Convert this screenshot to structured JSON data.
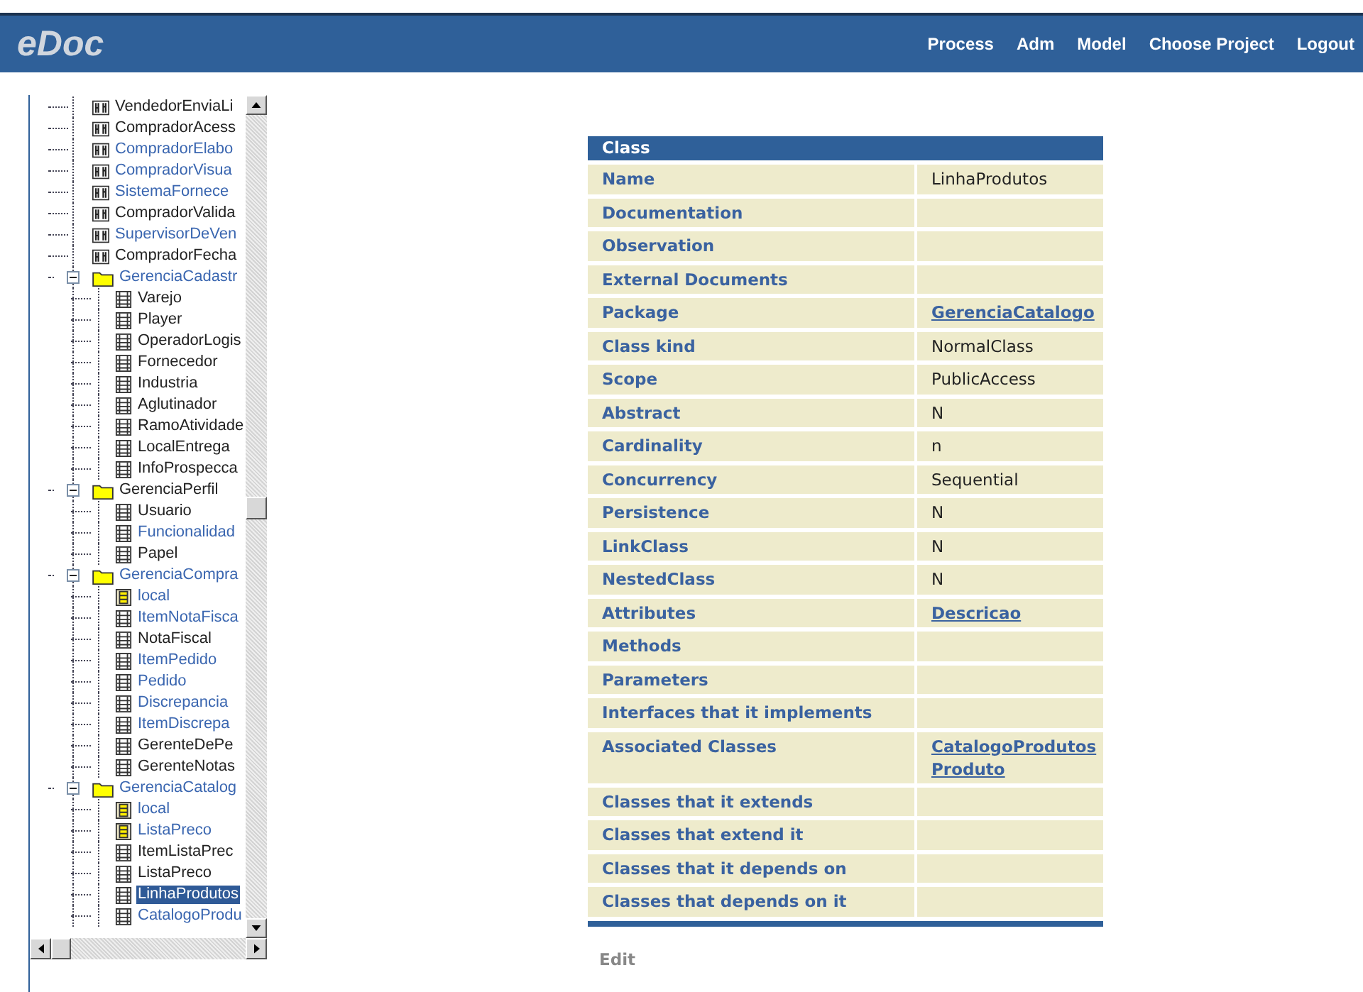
{
  "header": {
    "logo": "eDoc",
    "nav": [
      "Process",
      "Adm",
      "Model",
      "Choose Project",
      "Logout"
    ]
  },
  "tree": {
    "items": [
      {
        "label": "VendedorEnviaLi",
        "kind": "usecase",
        "link": false,
        "selected": false
      },
      {
        "label": "CompradorAcess",
        "kind": "usecase",
        "link": false,
        "selected": false
      },
      {
        "label": "CompradorElabo",
        "kind": "usecase",
        "link": true,
        "selected": false
      },
      {
        "label": "CompradorVisua",
        "kind": "usecase",
        "link": true,
        "selected": false
      },
      {
        "label": "SistemaFornece",
        "kind": "usecase",
        "link": true,
        "selected": false
      },
      {
        "label": "CompradorValida",
        "kind": "usecase",
        "link": false,
        "selected": false
      },
      {
        "label": "SupervisorDeVen",
        "kind": "usecase",
        "link": true,
        "selected": false
      },
      {
        "label": "CompradorFecha",
        "kind": "usecase",
        "link": false,
        "selected": false
      },
      {
        "label": "GerenciaCadastr",
        "kind": "folder",
        "link": true,
        "selected": false,
        "expanded": true,
        "children": [
          {
            "label": "Varejo",
            "kind": "class",
            "link": false,
            "selected": false
          },
          {
            "label": "Player",
            "kind": "class",
            "link": false,
            "selected": false
          },
          {
            "label": "OperadorLogis",
            "kind": "class",
            "link": false,
            "selected": false
          },
          {
            "label": "Fornecedor",
            "kind": "class",
            "link": false,
            "selected": false
          },
          {
            "label": "Industria",
            "kind": "class",
            "link": false,
            "selected": false
          },
          {
            "label": "Aglutinador",
            "kind": "class",
            "link": false,
            "selected": false
          },
          {
            "label": "RamoAtividade",
            "kind": "class",
            "link": false,
            "selected": false
          },
          {
            "label": "LocalEntrega",
            "kind": "class",
            "link": false,
            "selected": false
          },
          {
            "label": "InfoProspecca",
            "kind": "class",
            "link": false,
            "selected": false
          }
        ]
      },
      {
        "label": "GerenciaPerfil",
        "kind": "folder",
        "link": false,
        "selected": false,
        "expanded": true,
        "children": [
          {
            "label": "Usuario",
            "kind": "class",
            "link": false,
            "selected": false
          },
          {
            "label": "Funcionalidad",
            "kind": "class",
            "link": true,
            "selected": false
          },
          {
            "label": "Papel",
            "kind": "class",
            "link": false,
            "selected": false
          }
        ]
      },
      {
        "label": "GerenciaCompra",
        "kind": "folder",
        "link": true,
        "selected": false,
        "expanded": true,
        "children": [
          {
            "label": "local",
            "kind": "local",
            "link": true,
            "selected": false
          },
          {
            "label": "ItemNotaFisca",
            "kind": "class",
            "link": true,
            "selected": false
          },
          {
            "label": "NotaFiscal",
            "kind": "class",
            "link": false,
            "selected": false
          },
          {
            "label": "ItemPedido",
            "kind": "class",
            "link": true,
            "selected": false
          },
          {
            "label": "Pedido",
            "kind": "class",
            "link": true,
            "selected": false
          },
          {
            "label": "Discrepancia",
            "kind": "class",
            "link": true,
            "selected": false
          },
          {
            "label": "ItemDiscrepa",
            "kind": "class",
            "link": true,
            "selected": false
          },
          {
            "label": "GerenteDePe",
            "kind": "class",
            "link": false,
            "selected": false
          },
          {
            "label": "GerenteNotas",
            "kind": "class",
            "link": false,
            "selected": false
          }
        ]
      },
      {
        "label": "GerenciaCatalog",
        "kind": "folder",
        "link": true,
        "selected": false,
        "expanded": true,
        "children": [
          {
            "label": "local",
            "kind": "local",
            "link": true,
            "selected": false
          },
          {
            "label": "ListaPreco",
            "kind": "local",
            "link": true,
            "selected": false
          },
          {
            "label": "ItemListaPrec",
            "kind": "class",
            "link": false,
            "selected": false
          },
          {
            "label": "ListaPreco",
            "kind": "class",
            "link": false,
            "selected": false
          },
          {
            "label": "LinhaProdutos",
            "kind": "class",
            "link": false,
            "selected": true
          },
          {
            "label": "CatalogoProdu",
            "kind": "class",
            "link": true,
            "selected": false
          }
        ]
      }
    ]
  },
  "details": {
    "title": "Class",
    "rows": [
      {
        "label": "Name",
        "values": [
          {
            "text": "LinhaProdutos",
            "link": false
          }
        ]
      },
      {
        "label": "Documentation"
      },
      {
        "label": "Observation"
      },
      {
        "label": "External Documents"
      },
      {
        "label": "Package",
        "values": [
          {
            "text": "GerenciaCatalogo",
            "link": true
          }
        ]
      },
      {
        "label": "Class kind",
        "values": [
          {
            "text": "NormalClass",
            "link": false
          }
        ]
      },
      {
        "label": "Scope",
        "values": [
          {
            "text": "PublicAccess",
            "link": false
          }
        ]
      },
      {
        "label": "Abstract",
        "values": [
          {
            "text": "N",
            "link": false
          }
        ]
      },
      {
        "label": "Cardinality",
        "values": [
          {
            "text": "n",
            "link": false
          }
        ]
      },
      {
        "label": "Concurrency",
        "values": [
          {
            "text": "Sequential",
            "link": false
          }
        ]
      },
      {
        "label": "Persistence",
        "values": [
          {
            "text": "N",
            "link": false
          }
        ]
      },
      {
        "label": "LinkClass",
        "values": [
          {
            "text": "N",
            "link": false
          }
        ]
      },
      {
        "label": "NestedClass",
        "values": [
          {
            "text": "N",
            "link": false
          }
        ]
      },
      {
        "label": "Attributes",
        "values": [
          {
            "text": "Descricao",
            "link": true
          }
        ]
      },
      {
        "label": "Methods"
      },
      {
        "label": "Parameters"
      },
      {
        "label": "Interfaces that it implements"
      },
      {
        "label": "Associated Classes",
        "values": [
          {
            "text": "CatalogoProdutos",
            "link": true
          },
          {
            "text": "Produto",
            "link": true
          }
        ]
      },
      {
        "label": "Classes that it extends"
      },
      {
        "label": "Classes that extend it"
      },
      {
        "label": "Classes that it depends on"
      },
      {
        "label": "Classes that depends on it"
      }
    ],
    "action": "Edit"
  }
}
